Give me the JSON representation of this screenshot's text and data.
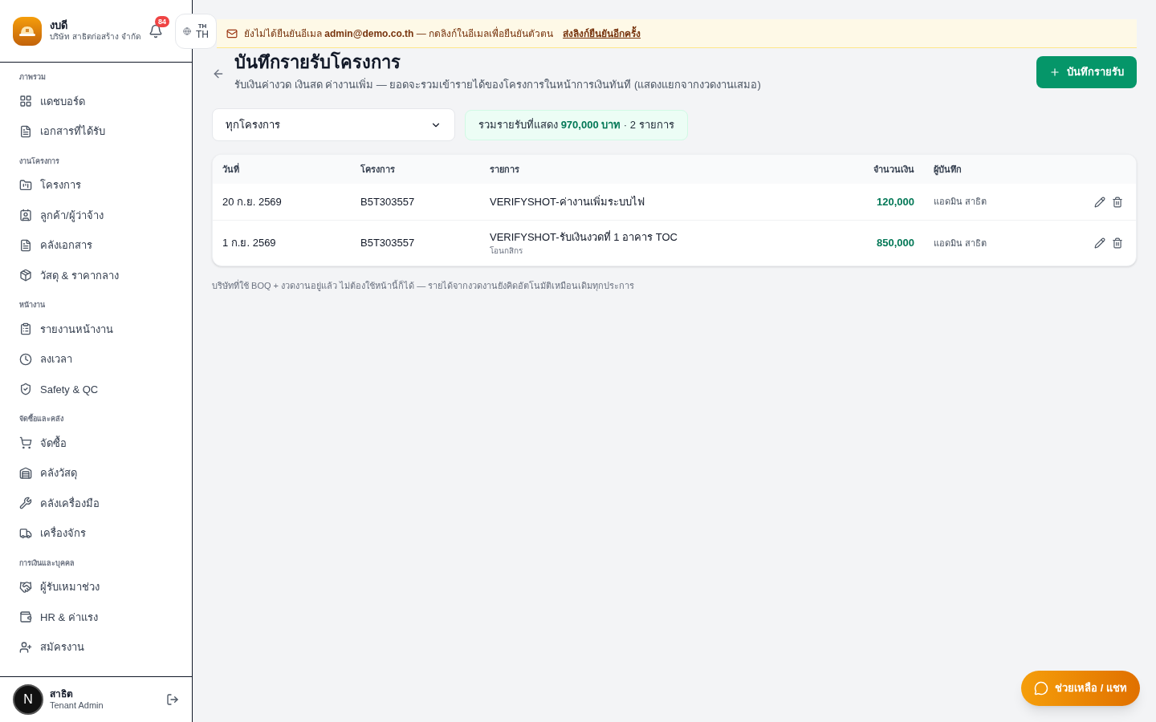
{
  "brand": {
    "name": "งบดี",
    "company": "บริษัท สาธิตก่อสร้าง จำกัด"
  },
  "notifications": {
    "count": "84"
  },
  "language": {
    "small": "TH",
    "label": "TH"
  },
  "sidebar": {
    "sections": [
      {
        "title": "ภาพรวม",
        "items": [
          {
            "kind": "dashboard",
            "label": "แดชบอร์ด"
          },
          {
            "kind": "file",
            "label": "เอกสารที่ได้รับ"
          }
        ]
      },
      {
        "title": "งานโครงการ",
        "items": [
          {
            "kind": "folder",
            "label": "โครงการ"
          },
          {
            "kind": "contact",
            "label": "ลูกค้า/ผู้ว่าจ้าง"
          },
          {
            "kind": "file",
            "label": "คลังเอกสาร"
          },
          {
            "kind": "box",
            "label": "วัสดุ & ราคากลาง"
          }
        ]
      },
      {
        "title": "หน้างาน",
        "items": [
          {
            "kind": "clipboard",
            "label": "รายงานหน้างาน"
          },
          {
            "kind": "clock",
            "label": "ลงเวลา"
          },
          {
            "kind": "shield",
            "label": "Safety & QC"
          }
        ]
      },
      {
        "title": "จัดซื้อและคลัง",
        "items": [
          {
            "kind": "cart",
            "label": "จัดซื้อ"
          },
          {
            "kind": "warehouse",
            "label": "คลังวัสดุ"
          },
          {
            "kind": "wrench",
            "label": "คลังเครื่องมือ"
          },
          {
            "kind": "truck",
            "label": "เครื่องจักร"
          }
        ]
      },
      {
        "title": "การเงินและบุคคล",
        "items": [
          {
            "kind": "handshake",
            "label": "ผู้รับเหมาช่วง"
          },
          {
            "kind": "wallet",
            "label": "HR & ค่าแรง"
          },
          {
            "kind": "userplus",
            "label": "สมัครงาน"
          }
        ]
      }
    ]
  },
  "user": {
    "avatar": "N",
    "name": "สาธิต",
    "role": "Tenant Admin"
  },
  "banner": {
    "text": "ยังไม่ได้ยืนยันอีเมล **admin@demo.co.th** — กดลิงก์ในอีเมลเพื่อยืนยันตัวตน",
    "link": "ส่งลิงก์ยืนยันอีกครั้ง"
  },
  "page": {
    "title": "บันทึกรายรับโครงการ",
    "subtitle": "รับเงินค่างวด เงินสด ค่างานเพิ่ม — ยอดจะรวมเข้ารายได้ของโครงการในหน้าการเงินทันที (แสดงแยกจากงวดงานเสมอ)",
    "add_button": "บันทึกรายรับ"
  },
  "filter": {
    "value": "ทุกโครงการ"
  },
  "summary": {
    "label": "รวมรายรับที่แสดง",
    "amount": "970,000 บาท",
    "count": "· 2 รายการ"
  },
  "table": {
    "columns": [
      "วันที่",
      "โครงการ",
      "รายการ",
      "จำนวนเงิน",
      "ผู้บันทึก"
    ],
    "rows": [
      {
        "date": "20 ก.ย. 2569",
        "project": "B5T303557",
        "item": "VERIFYSHOT-ค่างานเพิ่มระบบไฟ",
        "amount": "120,000",
        "recorder": "แอดมิน สาธิต"
      },
      {
        "date": "1 ก.ย. 2569",
        "project": "B5T303557",
        "item": "VERIFYSHOT-รับเงินงวดที่ 1 อาคาร TOC",
        "note": "โอนกสิกร",
        "amount": "850,000",
        "recorder": "แอดมิน สาธิต"
      }
    ]
  },
  "footnote": "บริษัทที่ใช้ BOQ + งวดงานอยู่แล้ว ไม่ต้องใช้หน้านี้ก็ได้ — รายได้จากงวดงานยังคิดอัตโนมัติเหมือนเดิมทุกประการ",
  "help_button": "ช่วยเหลือ / แชท"
}
